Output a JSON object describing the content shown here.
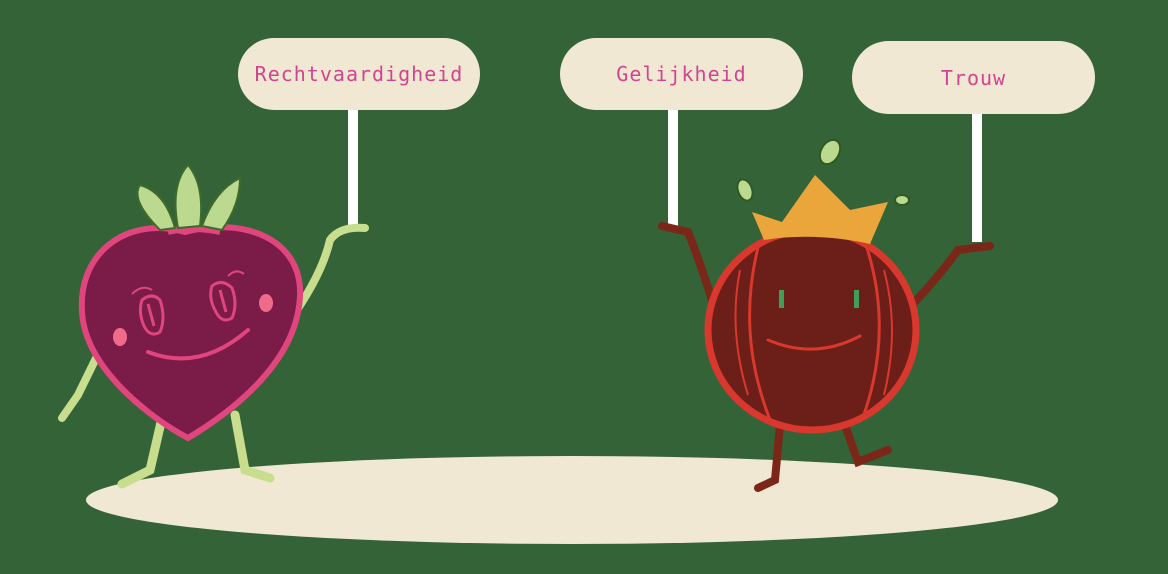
{
  "scene": {
    "background_color": "#346338",
    "ground_color": "#f1e8d4",
    "sign_text_color": "#d1448f"
  },
  "signs": [
    {
      "label": "Rechtvaardigheid"
    },
    {
      "label": "Gelijkheid"
    },
    {
      "label": "Trouw"
    }
  ],
  "characters": {
    "strawberry": {
      "body_color": "#7a1c47",
      "outline_color": "#e0457d",
      "leaf_color": "#bcd990",
      "limb_color": "#c9dd8e"
    },
    "tomato": {
      "body_color": "#6b1f18",
      "outline_color": "#d8382d",
      "crown_color": "#eaa63a",
      "limb_color": "#7a2618"
    }
  }
}
